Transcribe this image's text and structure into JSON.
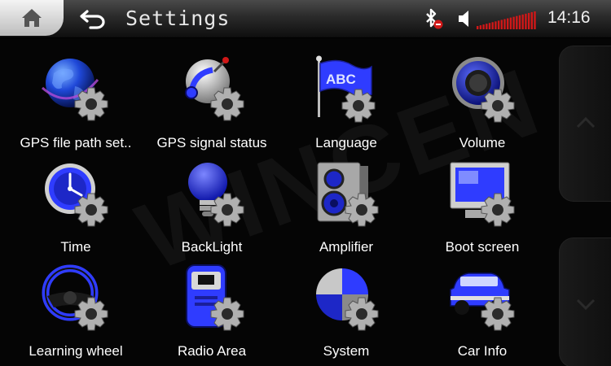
{
  "header": {
    "title": "Settings",
    "time": "14:16",
    "icons": [
      "home-icon",
      "back-arrow-icon",
      "bluetooth-off-icon",
      "speaker-icon",
      "volume-level-icon"
    ]
  },
  "volume": {
    "level": 1.0
  },
  "watermark": "WINCEN",
  "tiles": [
    {
      "label": "GPS file path set..",
      "icon": "globe-gear-icon"
    },
    {
      "label": "GPS signal status",
      "icon": "satellite-gear-icon"
    },
    {
      "label": "Language",
      "icon": "abc-flag-gear-icon"
    },
    {
      "label": "Volume",
      "icon": "speaker-gear-icon"
    },
    {
      "label": "Time",
      "icon": "clock-gear-icon"
    },
    {
      "label": "BackLight",
      "icon": "bulb-gear-icon"
    },
    {
      "label": "Amplifier",
      "icon": "amplifier-gear-icon"
    },
    {
      "label": "Boot screen",
      "icon": "monitor-gear-icon"
    },
    {
      "label": "Learning wheel",
      "icon": "steering-wheel-gear-icon"
    },
    {
      "label": "Radio Area",
      "icon": "radio-gear-icon"
    },
    {
      "label": "System",
      "icon": "pie-chart-gear-icon"
    },
    {
      "label": "Car Info",
      "icon": "car-gear-icon"
    }
  ],
  "colors": {
    "accent": "#2f3cff",
    "bar_red": "#d01818"
  }
}
